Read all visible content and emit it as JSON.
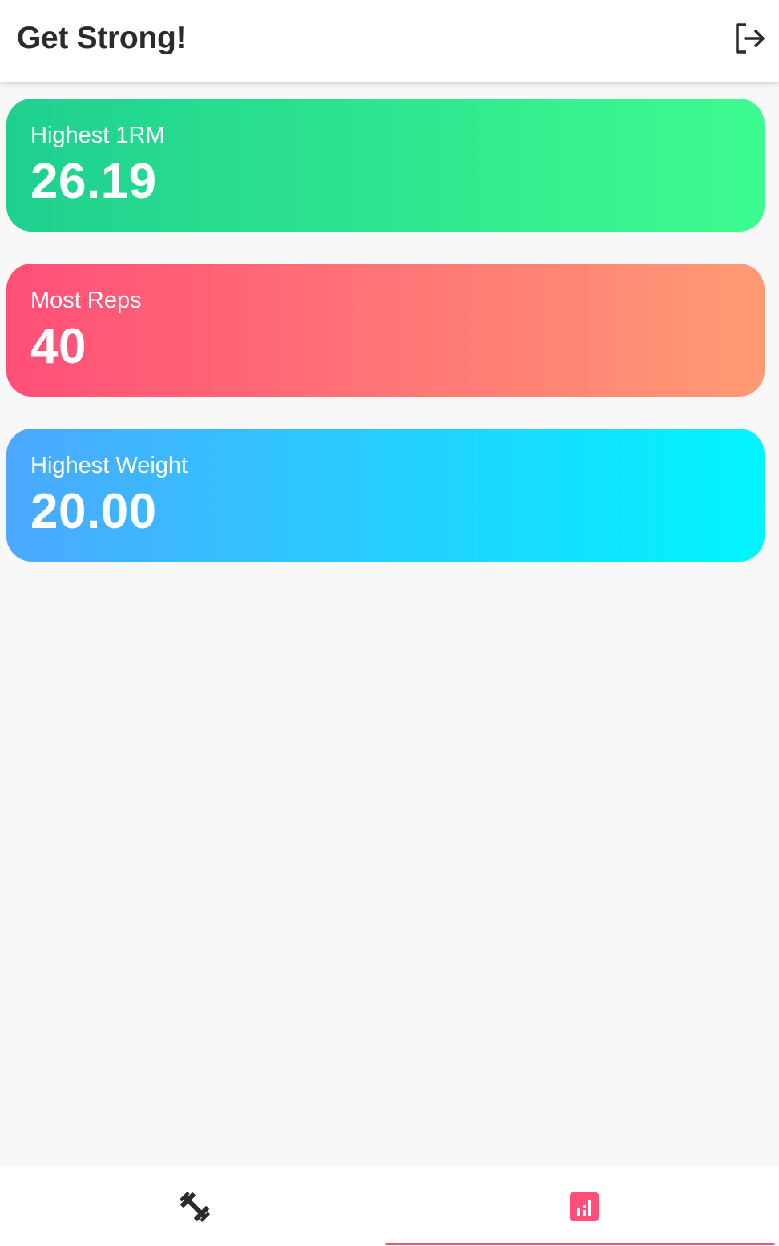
{
  "app_bar": {
    "title": "Get Strong!",
    "logout_icon": "logout-icon"
  },
  "cards": [
    {
      "label": "Highest 1RM",
      "value": "26.19",
      "gradient": [
        "#1fd08f",
        "#3dfc8f"
      ]
    },
    {
      "label": "Most Reps",
      "value": "40",
      "gradient": [
        "#ff4f78",
        "#ff9a74"
      ]
    },
    {
      "label": "Highest Weight",
      "value": "20.00",
      "gradient": [
        "#4ca8ff",
        "#00f5ff"
      ]
    }
  ],
  "bottom_nav": {
    "items": [
      {
        "icon": "dumbbell-icon",
        "active": false
      },
      {
        "icon": "bar-chart-icon",
        "active": true
      }
    ],
    "active_color": "#ff4f78"
  }
}
